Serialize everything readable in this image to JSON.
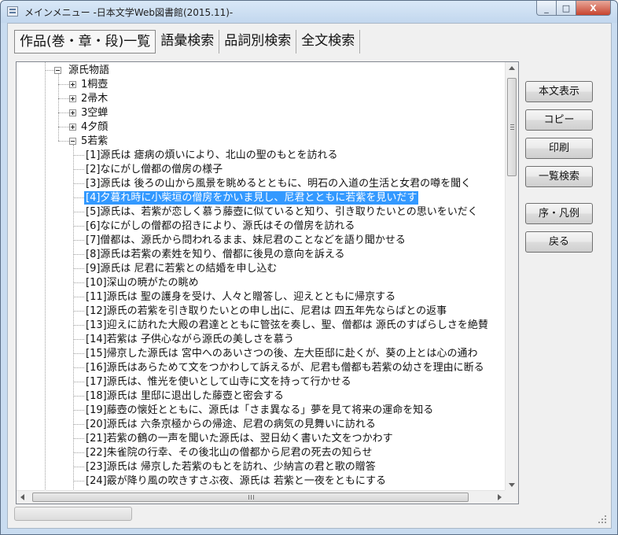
{
  "window": {
    "title": "メインメニュー -日本文学Web図書館(2015.11)-",
    "min_glyph": "_",
    "max_glyph": "□",
    "close_glyph": "X"
  },
  "tabs": [
    {
      "label": "作品(巻・章・段)一覧",
      "active": true
    },
    {
      "label": "語彙検索"
    },
    {
      "label": "品詞別検索"
    },
    {
      "label": "全文検索"
    }
  ],
  "tree": {
    "root": "源氏物語",
    "chapters": [
      {
        "label": "1桐壺",
        "expanded": false
      },
      {
        "label": "2帚木",
        "expanded": false
      },
      {
        "label": "3空蝉",
        "expanded": false
      },
      {
        "label": "4夕顔",
        "expanded": false
      },
      {
        "label": "5若紫",
        "expanded": true
      }
    ],
    "sections": [
      "[1]源氏は 瘧病の煩いにより、北山の聖のもとを訪れる",
      "[2]なにがし僧都の僧房の様子",
      "[3]源氏は 後ろの山から風景を眺めるとともに、明石の入道の生活と女君の噂を聞く",
      "[4]夕暮れ時に小柴垣の僧房をかいま見し、尼君とともに若紫を見いだす",
      "[5]源氏は、若紫が恋しく慕う藤壺に似ていると知り、引き取りたいとの思いをいだく",
      "[6]なにがしの僧都の招きにより、源氏はその僧房を訪れる",
      "[7]僧都は、源氏から問われるまま、妹尼君のことなどを語り聞かせる",
      "[8]源氏は若紫の素姓を知り、僧都に後見の意向を訴える",
      "[9]源氏は 尼君に若紫との結婚を申し込む",
      "[10]深山の暁がたの眺め",
      "[11]源氏は 聖の護身を受け、人々と贈答し、迎えとともに帰京する",
      "[12]源氏の若紫を引き取りたいとの申し出に、尼君は 四五年先ならばとの返事",
      "[13]迎えに訪れた大殿の君達とともに管弦を奏し、聖、僧都は 源氏のすばらしさを絶賛",
      "[14]若紫は 子供心ながら源氏の美しさを慕う",
      "[15]帰京した源氏は 宮中へのあいさつの後、左大臣邸に赴くが、葵の上とは心の通わ",
      "[16]源氏はあらためて文をつかわして訴えるが、尼君も僧都も若紫の幼さを理由に断る",
      "[17]源氏は、惟光を使いとして山寺に文を持って行かせる",
      "[18]源氏は 里邸に退出した藤壺と密会する",
      "[19]藤壺の懐妊とともに、源氏は「さま異なる」夢を見て将来の運命を知る",
      "[20]源氏は 六条京極からの帰途、尼君の病気の見舞いに訪れる",
      "[21]若紫の鶴の一声を聞いた源氏は、翌日幼く書いた文をつかわす",
      "[22]朱雀院の行幸、その後北山の僧都から尼君の死去の知らせ",
      "[23]源氏は 帰京した若紫のもとを訪れ、少納言の君と歌の贈答",
      "[24]霰が降り風の吹きすさぶ夜、源氏は 若紫と一夜をともにする"
    ],
    "selected_index": 3
  },
  "buttons": {
    "show_text": "本文表示",
    "copy": "コピー",
    "print": "印刷",
    "list_search": "一覧検索",
    "preface": "序・凡例",
    "back": "戻る"
  }
}
